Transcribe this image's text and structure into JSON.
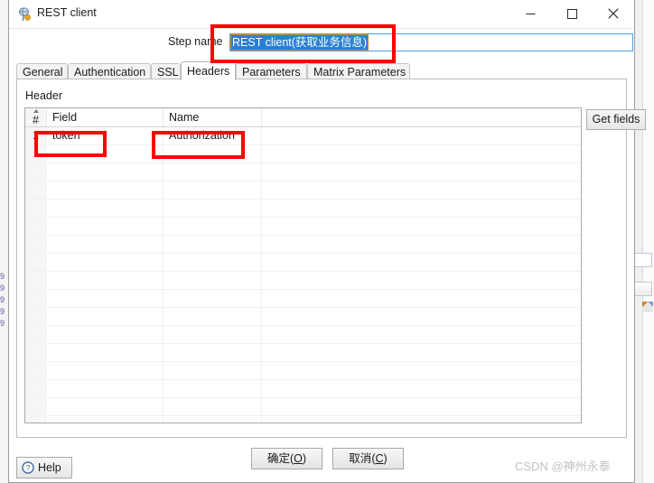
{
  "window": {
    "title": "REST client",
    "icon": "rest-client-icon",
    "controls": {
      "minimize": "minimize-icon",
      "maximize": "maximize-icon",
      "close": "close-icon"
    }
  },
  "step": {
    "label": "Step name",
    "value": "REST client(获取业务信息)",
    "selected": true
  },
  "tabs": [
    {
      "label": "General",
      "selected": false
    },
    {
      "label": "Authentication",
      "selected": false
    },
    {
      "label": "SSL",
      "selected": false
    },
    {
      "label": "Headers",
      "selected": true
    },
    {
      "label": "Parameters",
      "selected": false
    },
    {
      "label": "Matrix Parameters",
      "selected": false
    }
  ],
  "panel": {
    "group_label": "Header",
    "table": {
      "columns": [
        "#",
        "Field",
        "Name",
        ""
      ],
      "rows": [
        {
          "index": "1",
          "field": "token",
          "name": "Authorization",
          "extra": ""
        }
      ],
      "empty_row_count": 17
    },
    "get_fields_label": "Get fields"
  },
  "footer": {
    "help_label": "Help",
    "help_icon": "question-mark-icon",
    "ok_label": "确定",
    "ok_mnemonic": "O",
    "cancel_label": "取消",
    "cancel_mnemonic": "C",
    "watermark": "CSDN @神州永泰"
  },
  "annotations": {
    "step_name_box": "highlight-step-name",
    "field_box": "highlight-field-token",
    "name_box": "highlight-name-authorization",
    "color": "#ff0000"
  },
  "background": {
    "left_text": "9 9 9 9 9"
  }
}
